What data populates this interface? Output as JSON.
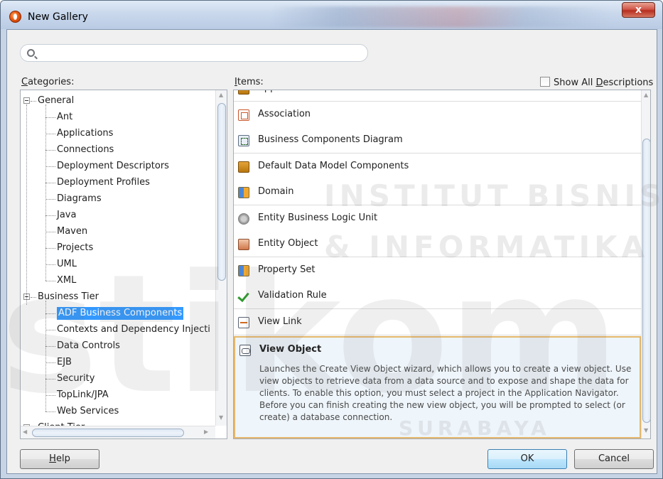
{
  "window": {
    "title": "New Gallery",
    "close_glyph": "x"
  },
  "search": {
    "placeholder": "",
    "icon": "search-icon"
  },
  "categories": {
    "header_prefix": "C",
    "header_rest": "ategories:",
    "tree": [
      {
        "label": "General",
        "level": 0,
        "expanded": true
      },
      {
        "label": "Ant",
        "level": 1
      },
      {
        "label": "Applications",
        "level": 1
      },
      {
        "label": "Connections",
        "level": 1
      },
      {
        "label": "Deployment Descriptors",
        "level": 1
      },
      {
        "label": "Deployment Profiles",
        "level": 1
      },
      {
        "label": "Diagrams",
        "level": 1
      },
      {
        "label": "Java",
        "level": 1
      },
      {
        "label": "Maven",
        "level": 1
      },
      {
        "label": "Projects",
        "level": 1
      },
      {
        "label": "UML",
        "level": 1
      },
      {
        "label": "XML",
        "level": 1
      },
      {
        "label": "Business Tier",
        "level": 0,
        "expanded": true
      },
      {
        "label": "ADF Business Components",
        "level": 1,
        "selected": true
      },
      {
        "label": "Contexts and Dependency Injecti",
        "level": 1
      },
      {
        "label": "Data Controls",
        "level": 1
      },
      {
        "label": "EJB",
        "level": 1
      },
      {
        "label": "Security",
        "level": 1
      },
      {
        "label": "TopLink/JPA",
        "level": 1
      },
      {
        "label": "Web Services",
        "level": 1
      },
      {
        "label": "Client Tier",
        "level": 0,
        "expanded": true
      }
    ]
  },
  "items": {
    "header_prefix": "I",
    "header_rest": "tems:",
    "show_all_prefix": "Show All ",
    "show_all_underlined": "D",
    "show_all_rest": "escriptions",
    "show_all_checked": false,
    "list": [
      {
        "label": "Application Module",
        "icon": "briefcase-icon"
      },
      {
        "label": "Association",
        "icon": "association-icon"
      },
      {
        "label": "Business Components Diagram",
        "icon": "diagram-icon"
      },
      {
        "label": "Default Data Model Components",
        "icon": "briefcase-icon"
      },
      {
        "label": "Domain",
        "icon": "domain-icon"
      },
      {
        "label": "Entity Business Logic Unit",
        "icon": "logic-unit-icon"
      },
      {
        "label": "Entity Object",
        "icon": "entity-object-icon"
      },
      {
        "label": "Property Set",
        "icon": "domain-icon"
      },
      {
        "label": "Validation Rule",
        "icon": "check-icon"
      },
      {
        "label": "View Link",
        "icon": "view-link-icon"
      }
    ],
    "selected": {
      "label": "View Object",
      "icon": "view-object-icon",
      "description": "Launches the Create View Object wizard, which allows you to create a view object. Use view objects to retrieve data from a data source and to expose and shape the data for clients. To enable this option, you must select a project in the Application Navigator. Before you can finish creating the new view object, you will be prompted to select (or create) a database connection."
    }
  },
  "buttons": {
    "help_prefix": "H",
    "help_rest": "elp",
    "ok": "OK",
    "cancel": "Cancel"
  },
  "watermark": {
    "line1": "INSTITUT BISNIS",
    "line2": "& INFORMATIKA",
    "logo": "stikom",
    "footer": "SURABAYA"
  }
}
